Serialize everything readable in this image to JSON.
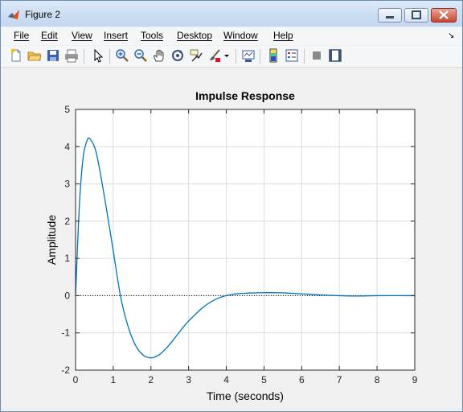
{
  "window": {
    "title": "Figure 2"
  },
  "menu": {
    "items": [
      "File",
      "Edit",
      "View",
      "Insert",
      "Tools",
      "Desktop",
      "Window",
      "Help"
    ]
  },
  "toolbar": {
    "icons": [
      "new-figure-icon",
      "open-file-icon",
      "save-icon",
      "print-icon",
      "pointer-icon",
      "zoom-in-icon",
      "zoom-out-icon",
      "pan-icon",
      "rotate-3d-icon",
      "data-cursor-icon",
      "brush-icon",
      "link-plot-icon",
      "insert-colorbar-icon",
      "insert-legend-icon",
      "hide-plot-tools-icon",
      "show-plot-tools-icon"
    ]
  },
  "colors": {
    "line": "#0072bd",
    "grid": "#dcdcdc",
    "axes_bg": "#ffffff",
    "figure_bg": "#f0f0f0"
  },
  "chart_data": {
    "type": "line",
    "title": "Impulse Response",
    "xlabel": "Time (seconds)",
    "ylabel": "Amplitude",
    "xlim": [
      0,
      9
    ],
    "ylim": [
      -2,
      5
    ],
    "xticks": [
      "0",
      "1",
      "2",
      "3",
      "4",
      "5",
      "6",
      "7",
      "8",
      "9"
    ],
    "yticks": [
      "-2",
      "-1",
      "0",
      "1",
      "2",
      "3",
      "4",
      "5"
    ],
    "grid": true,
    "reference_line": {
      "y": 0,
      "style": "dotted"
    },
    "series": [
      {
        "color": "#0072bd",
        "x": [
          0,
          0.1,
          0.2,
          0.3,
          0.37,
          0.5,
          0.6,
          0.8,
          1.0,
          1.2,
          1.4,
          1.6,
          1.8,
          2.0,
          2.2,
          2.4,
          2.6,
          2.8,
          3.0,
          3.4,
          3.8,
          4.2,
          4.6,
          5.0,
          5.3,
          5.6,
          6.0,
          6.5,
          7.0,
          7.5,
          8.0,
          9.0
        ],
        "y": [
          0,
          2.4,
          3.7,
          4.15,
          4.22,
          4.0,
          3.6,
          2.45,
          1.2,
          -0.05,
          -0.85,
          -1.35,
          -1.6,
          -1.67,
          -1.6,
          -1.42,
          -1.18,
          -0.92,
          -0.68,
          -0.3,
          -0.06,
          0.04,
          0.07,
          0.08,
          0.08,
          0.07,
          0.05,
          0.02,
          0.0,
          -0.01,
          0.0,
          0.0
        ]
      }
    ]
  }
}
